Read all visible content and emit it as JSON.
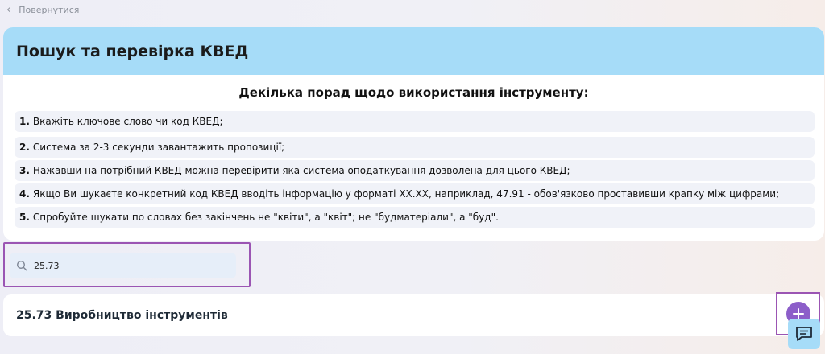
{
  "nav": {
    "back_label": "Повернутися"
  },
  "card": {
    "title": "Пошук та перевірка КВЕД",
    "tips_title": "Декілька порад щодо використання інструменту:",
    "tips": [
      {
        "num": "1.",
        "text": "Вкажіть ключове слово чи код КВЕД;"
      },
      {
        "num": "2.",
        "text": "Система за 2-3 секунди завантажить пропозиції;"
      },
      {
        "num": "3.",
        "text": "Нажавши на потрібний КВЕД можна перевірити яка система оподаткування дозволена для цього КВЕД;"
      },
      {
        "num": "4.",
        "text": "Якщо Ви шукаєте конкретний код КВЕД вводіть інформацію у форматі XX.XX, наприклад, 47.91 - обов'язково проставивши крапку між цифрами;"
      },
      {
        "num": "5.",
        "text": "Спробуйте шукати по словах без закінчень не \"квіти\", а \"квіт\"; не \"будматеріали\", а \"буд\"."
      }
    ]
  },
  "search": {
    "value": "25.73"
  },
  "results": [
    {
      "label": "25.73 Виробництво інструментів"
    }
  ],
  "colors": {
    "header_bg": "#a6dcf8",
    "accent_purple": "#8c5ec9",
    "highlight_border": "#9b55b3"
  },
  "icons": [
    "chevron-left-icon",
    "search-icon",
    "plus-icon",
    "chat-icon"
  ]
}
